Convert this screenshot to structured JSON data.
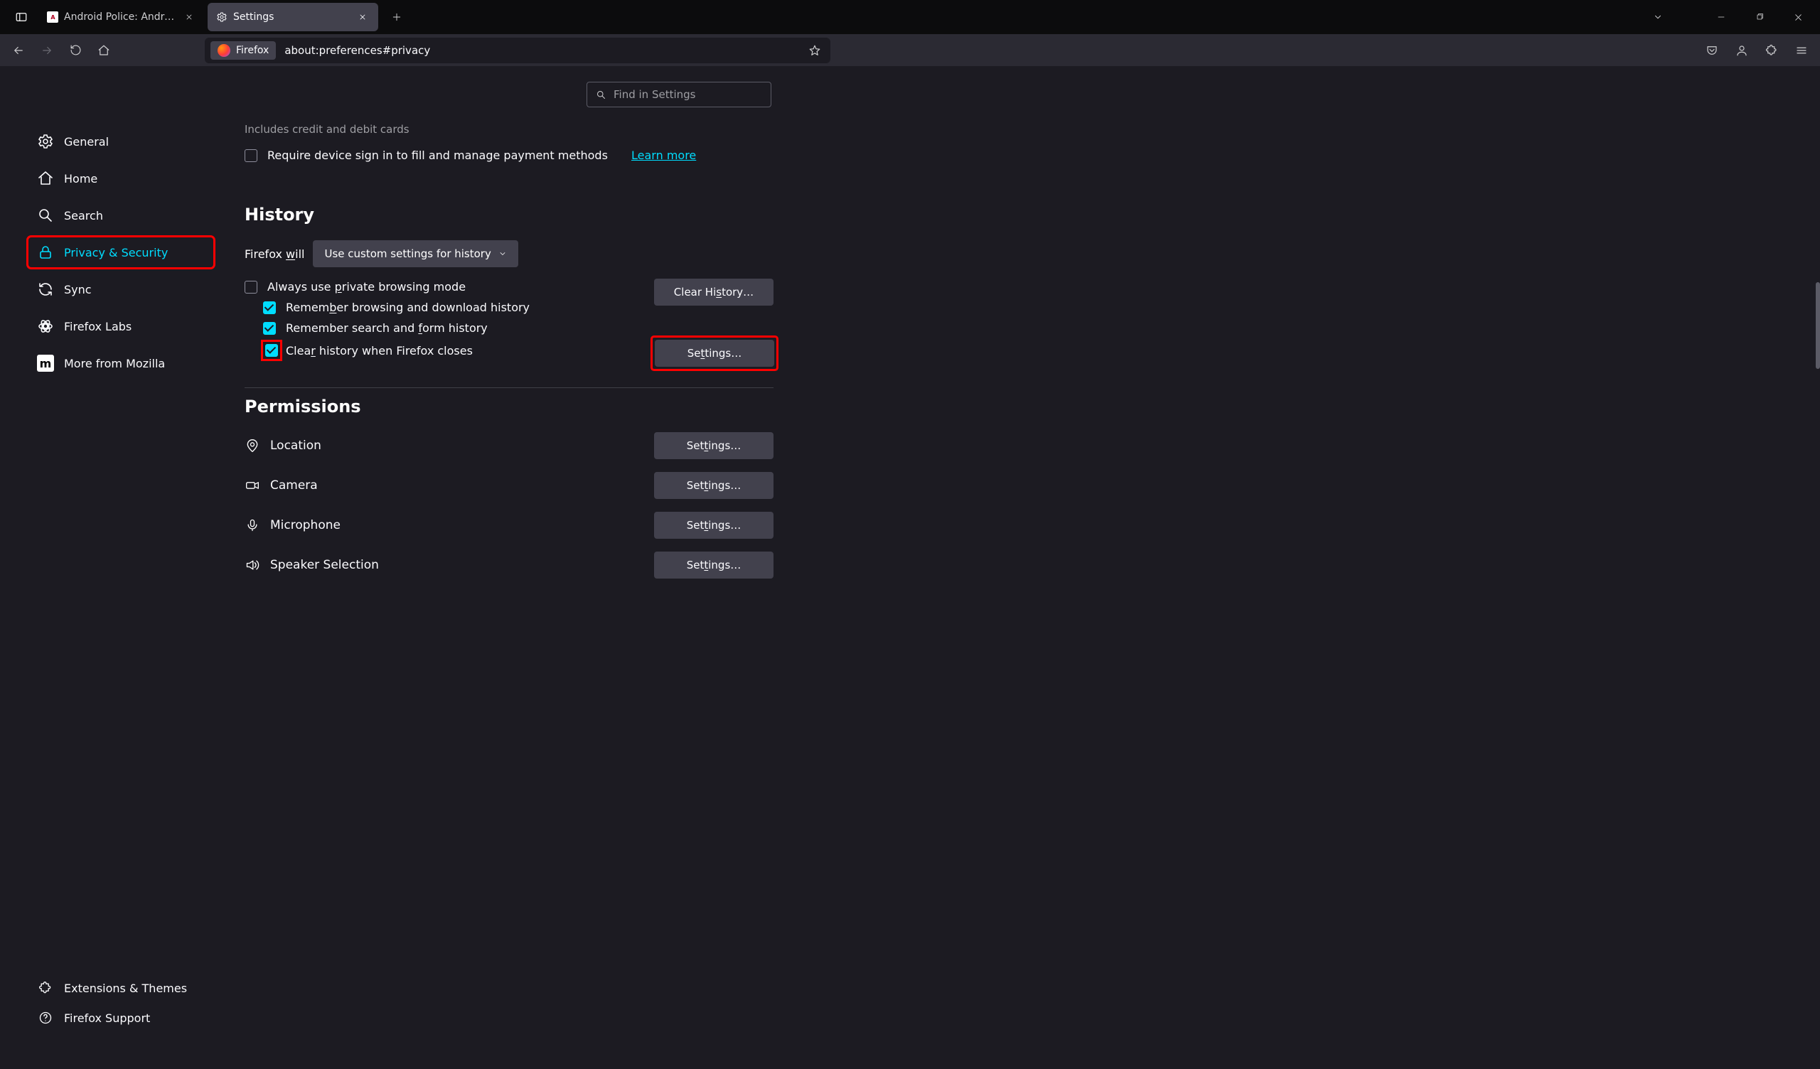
{
  "titlebar": {
    "tabs": [
      {
        "label": "Android Police: Android news, r"
      },
      {
        "label": "Settings"
      }
    ]
  },
  "navbar": {
    "identity_label": "Firefox",
    "url": "about:preferences#privacy"
  },
  "search": {
    "placeholder": "Find in Settings"
  },
  "sidebar": {
    "items": [
      {
        "label": "General"
      },
      {
        "label": "Home"
      },
      {
        "label": "Search"
      },
      {
        "label": "Privacy & Security"
      },
      {
        "label": "Sync"
      },
      {
        "label": "Firefox Labs"
      },
      {
        "label": "More from Mozilla"
      }
    ],
    "bottom": [
      {
        "label": "Extensions & Themes"
      },
      {
        "label": "Firefox Support"
      }
    ]
  },
  "main": {
    "payments_sub": "Includes credit and debit cards",
    "require_signin": "Require device sign in to fill and manage payment methods",
    "learn_more": "Learn more",
    "history_heading": "History",
    "will_prefix": "Firefox ",
    "will_mn": "w",
    "will_suffix": "ill",
    "history_mode": "Use custom settings for history",
    "always_private_pre": "Always use ",
    "always_private_mn": "p",
    "always_private_post": "rivate browsing mode",
    "clear_history_btn_pre": "Clear Hi",
    "clear_history_btn_mn": "s",
    "clear_history_btn_post": "tory…",
    "remember_browsing_pre": "Remem",
    "remember_browsing_mn": "b",
    "remember_browsing_post": "er browsing and download history",
    "remember_forms_pre": "Remember search and ",
    "remember_forms_mn": "f",
    "remember_forms_post": "orm history",
    "clear_on_close_pre": "Clea",
    "clear_on_close_mn": "r",
    "clear_on_close_post": " history when Firefox closes",
    "settings_btn_pre": "Se",
    "settings_btn_mn": "t",
    "settings_btn_post": "tings…",
    "permissions_heading": "Permissions",
    "perm_location": "Location",
    "perm_camera": "Camera",
    "perm_microphone": "Microphone",
    "perm_speaker": "Speaker Selection",
    "perm_settings_pre": "Set",
    "perm_settings_mn": "t",
    "perm_settings_post": "ings…"
  }
}
